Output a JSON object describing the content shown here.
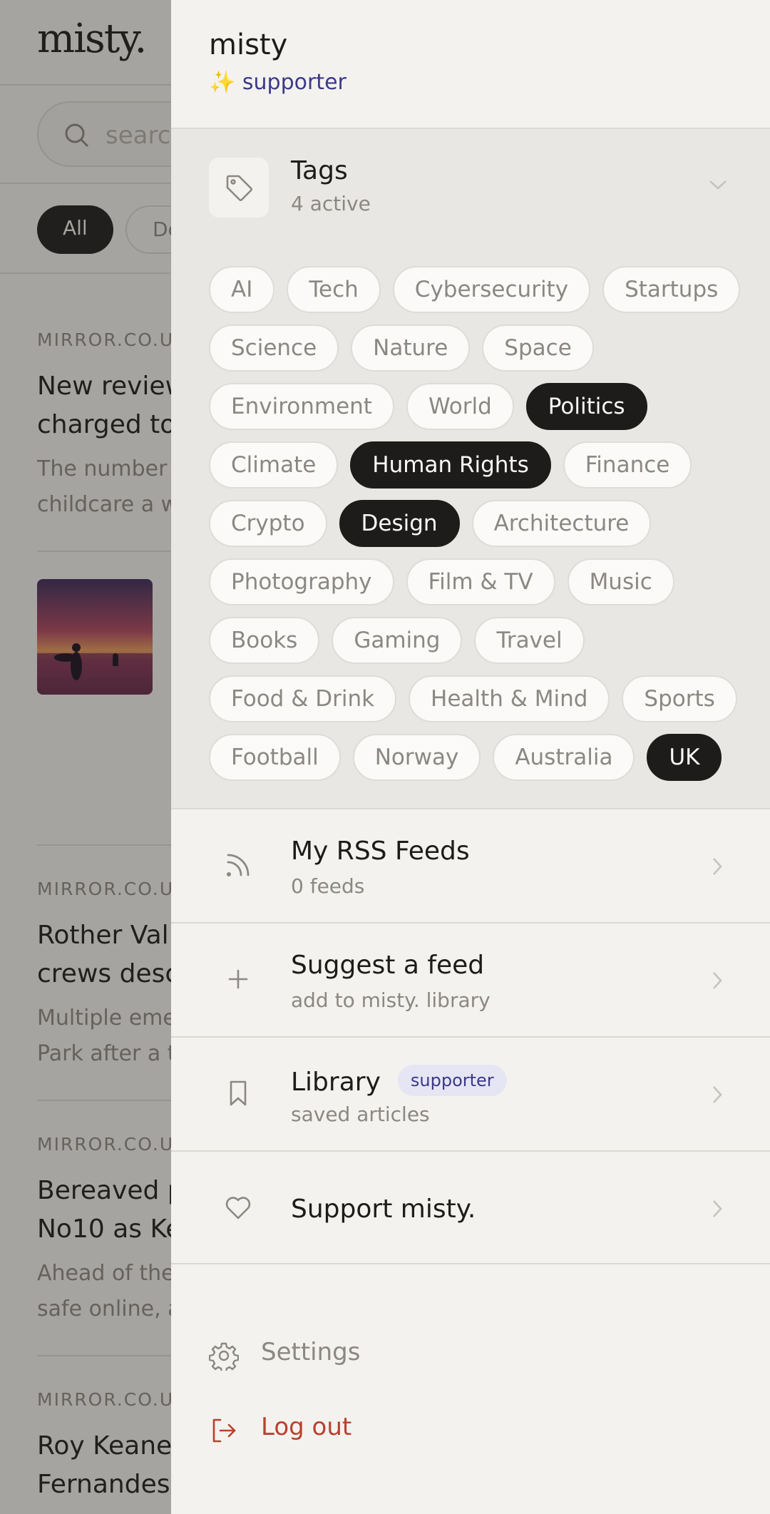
{
  "background": {
    "logo": "misty.",
    "search_placeholder": "search",
    "filter_all": "All",
    "filter_other": "De",
    "articles": [
      {
        "source": "MIRROR.CO.UK",
        "title_l1": "New review",
        "title_l2": "charged to",
        "desc_l1": "The number",
        "desc_l2": "childcare a w"
      },
      {
        "source": "MIRROR.CO.UK",
        "title_l1": "Rother Vall",
        "title_l2": "crews desc",
        "desc_l1": "Multiple eme",
        "desc_l2": "Park after a t"
      },
      {
        "source": "MIRROR.CO.UK",
        "title_l1": "Bereaved p",
        "title_l2": "No10 as Ke",
        "desc_l1": "Ahead of the",
        "desc_l2": "safe online, a"
      },
      {
        "source": "MIRROR.CO.UK",
        "title_l1": "Roy Keane",
        "title_l2": "Fernandes"
      }
    ]
  },
  "drawer": {
    "user_name": "misty",
    "user_status": "✨ supporter",
    "tags": {
      "title": "Tags",
      "subtitle": "4 active",
      "items": [
        {
          "label": "AI",
          "active": false
        },
        {
          "label": "Tech",
          "active": false
        },
        {
          "label": "Cybersecurity",
          "active": false
        },
        {
          "label": "Startups",
          "active": false
        },
        {
          "label": "Science",
          "active": false
        },
        {
          "label": "Nature",
          "active": false
        },
        {
          "label": "Space",
          "active": false
        },
        {
          "label": "Environment",
          "active": false
        },
        {
          "label": "World",
          "active": false
        },
        {
          "label": "Politics",
          "active": true
        },
        {
          "label": "Climate",
          "active": false
        },
        {
          "label": "Human Rights",
          "active": true
        },
        {
          "label": "Finance",
          "active": false
        },
        {
          "label": "Crypto",
          "active": false
        },
        {
          "label": "Design",
          "active": true
        },
        {
          "label": "Architecture",
          "active": false
        },
        {
          "label": "Photography",
          "active": false
        },
        {
          "label": "Film & TV",
          "active": false
        },
        {
          "label": "Music",
          "active": false
        },
        {
          "label": "Books",
          "active": false
        },
        {
          "label": "Gaming",
          "active": false
        },
        {
          "label": "Travel",
          "active": false
        },
        {
          "label": "Food & Drink",
          "active": false
        },
        {
          "label": "Health & Mind",
          "active": false
        },
        {
          "label": "Sports",
          "active": false
        },
        {
          "label": "Football",
          "active": false
        },
        {
          "label": "Norway",
          "active": false
        },
        {
          "label": "Australia",
          "active": false
        },
        {
          "label": "UK",
          "active": true
        }
      ]
    },
    "menu": {
      "rss": {
        "title": "My RSS Feeds",
        "subtitle": "0 feeds"
      },
      "suggest": {
        "title": "Suggest a feed",
        "subtitle": "add to misty. library"
      },
      "library": {
        "title": "Library",
        "badge": "supporter",
        "subtitle": "saved articles"
      },
      "support": {
        "title": "Support misty."
      }
    },
    "settings_label": "Settings",
    "logout_label": "Log out"
  },
  "colors": {
    "accent_dark": "#1d1c1a",
    "supporter_text": "#3b3a86",
    "logout": "#b8412e"
  }
}
